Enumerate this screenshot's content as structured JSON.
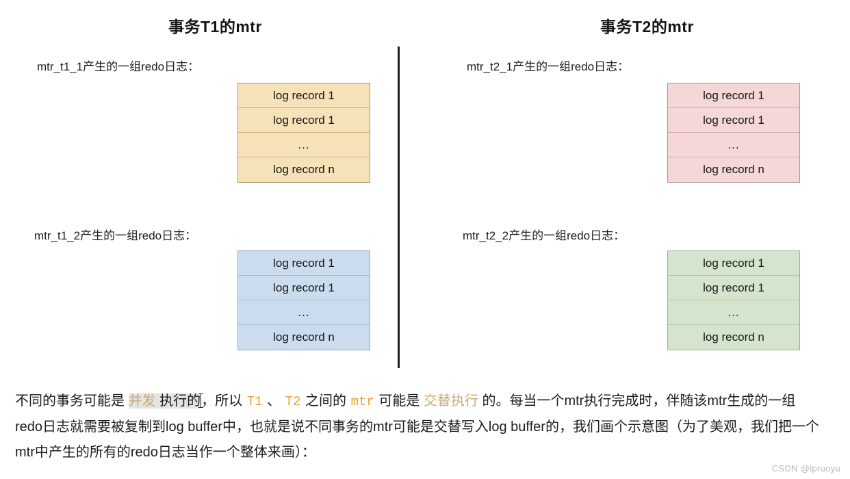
{
  "diagram": {
    "column_titles": {
      "left": "事务T1的mtr",
      "right": "事务T2的mtr"
    },
    "groups": [
      {
        "id": "mtr_t1_1",
        "label": "mtr_t1_1产生的一组redo日志：",
        "color": "#f6e2b8",
        "border_color": "#a79360",
        "rows": [
          "log record 1",
          "log record 1",
          "...",
          "log record n"
        ]
      },
      {
        "id": "mtr_t2_1",
        "label": "mtr_t2_1产生的一组redo日志：",
        "color": "#f5d7d7",
        "border_color": "#b98f8f",
        "rows": [
          "log record 1",
          "log record 1",
          "...",
          "log record n"
        ]
      },
      {
        "id": "mtr_t1_2",
        "label": "mtr_t1_2产生的一组redo日志：",
        "color": "#ccdcef",
        "border_color": "#8fa7c4",
        "rows": [
          "log record 1",
          "log record 1",
          "...",
          "log record n"
        ]
      },
      {
        "id": "mtr_t2_2",
        "label": "mtr_t2_2产生的一组redo日志：",
        "color": "#d5e5cd",
        "border_color": "#9bb092",
        "rows": [
          "log record 1",
          "log record 1",
          "...",
          "log record n"
        ]
      }
    ]
  },
  "paragraph": {
    "seg1": "不同的事务可能是 ",
    "seg2_highlight": "并发",
    "seg3": " 执行的",
    "seg4": "，所以 ",
    "code_t1": "T1",
    "seg5": " 、 ",
    "code_t2": "T2",
    "seg6": " 之间的 ",
    "code_mtr": "mtr",
    "seg7": " 可能是 ",
    "seg8_highlight": "交替执行",
    "seg9": " 的。每当一个mtr执行完成时，伴随该mtr生成的一组redo日志就需要被复制到log buffer中，也就是说不同事务的mtr可能是交替写入log buffer的，我们画个示意图（为了美观，我们把一个mtr中产生的所有的redo日志当作一个整体来画）："
  },
  "watermark": "CSDN @lpruoyu",
  "chart_data": {
    "type": "diagram",
    "title": "事务T1/T2的mtr与redo日志分组示意图",
    "columns": [
      {
        "title": "事务T1的mtr",
        "groups": [
          {
            "label": "mtr_t1_1产生的一组redo日志：",
            "records": [
              "log record 1",
              "log record 1",
              "...",
              "log record n"
            ],
            "fill": "#f6e2b8"
          },
          {
            "label": "mtr_t1_2产生的一组redo日志：",
            "records": [
              "log record 1",
              "log record 1",
              "...",
              "log record n"
            ],
            "fill": "#ccdcef"
          }
        ]
      },
      {
        "title": "事务T2的mtr",
        "groups": [
          {
            "label": "mtr_t2_1产生的一组redo日志：",
            "records": [
              "log record 1",
              "log record 1",
              "...",
              "log record n"
            ],
            "fill": "#f5d7d7"
          },
          {
            "label": "mtr_t2_2产生的一组redo日志：",
            "records": [
              "log record 1",
              "log record 1",
              "...",
              "log record n"
            ],
            "fill": "#d5e5cd"
          }
        ]
      }
    ]
  }
}
